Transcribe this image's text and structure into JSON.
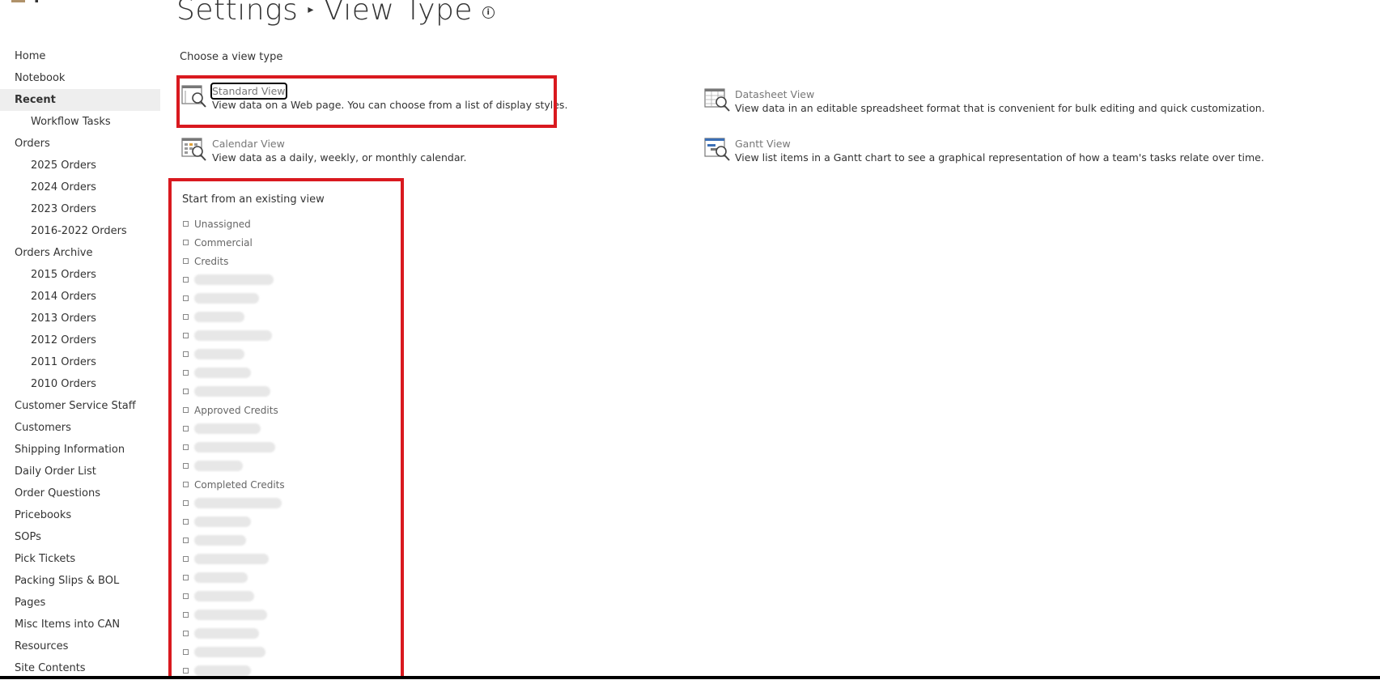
{
  "header": {
    "crumb_root": "Settings",
    "crumb_separator": "▸",
    "crumb_current": "View Type",
    "info_glyph": "i"
  },
  "nav": [
    {
      "label": "Home",
      "level": 0
    },
    {
      "label": "Notebook",
      "level": 0
    },
    {
      "label": "Recent",
      "level": 0,
      "active": true
    },
    {
      "label": "Workflow Tasks",
      "level": 1
    },
    {
      "label": "Orders",
      "level": 0
    },
    {
      "label": "2025 Orders",
      "level": 1
    },
    {
      "label": "2024 Orders",
      "level": 1
    },
    {
      "label": "2023 Orders",
      "level": 1
    },
    {
      "label": "2016-2022 Orders",
      "level": 1
    },
    {
      "label": "Orders Archive",
      "level": 0
    },
    {
      "label": "2015 Orders",
      "level": 1
    },
    {
      "label": "2014 Orders",
      "level": 1
    },
    {
      "label": "2013 Orders",
      "level": 1
    },
    {
      "label": "2012 Orders",
      "level": 1
    },
    {
      "label": "2011 Orders",
      "level": 1
    },
    {
      "label": "2010 Orders",
      "level": 1
    },
    {
      "label": "Customer Service Staff",
      "level": 0
    },
    {
      "label": "Customers",
      "level": 0
    },
    {
      "label": "Shipping Information",
      "level": 0
    },
    {
      "label": "Daily Order List",
      "level": 0
    },
    {
      "label": "Order Questions",
      "level": 0
    },
    {
      "label": "Pricebooks",
      "level": 0
    },
    {
      "label": "SOPs",
      "level": 0
    },
    {
      "label": "Pick Tickets",
      "level": 0
    },
    {
      "label": "Packing Slips & BOL",
      "level": 0
    },
    {
      "label": "Pages",
      "level": 0
    },
    {
      "label": "Misc Items into CAN",
      "level": 0
    },
    {
      "label": "Resources",
      "level": 0
    },
    {
      "label": "Site Contents",
      "level": 0
    }
  ],
  "main": {
    "choose_label": "Choose a view type",
    "view_types": {
      "standard": {
        "name": "Standard View",
        "desc": "View data on a Web page. You can choose from a list of display styles.",
        "icon": "standard-view-icon"
      },
      "datasheet": {
        "name": "Datasheet View",
        "desc": "View data in an editable spreadsheet format that is convenient for bulk editing and quick customization.",
        "icon": "datasheet-view-icon"
      },
      "calendar": {
        "name": "Calendar View",
        "desc": "View data as a daily, weekly, or monthly calendar.",
        "icon": "calendar-view-icon"
      },
      "gantt": {
        "name": "Gantt View",
        "desc": "View list items in a Gantt chart to see a graphical representation of how a team's tasks relate over time.",
        "icon": "gantt-view-icon"
      }
    },
    "existing_title": "Start from an existing view",
    "existing_views": [
      {
        "label": "Unassigned"
      },
      {
        "label": "Commercial"
      },
      {
        "label": "Credits"
      },
      {
        "label": "",
        "redacted": true
      },
      {
        "label": "",
        "redacted": true
      },
      {
        "label": "",
        "redacted": true
      },
      {
        "label": "",
        "redacted": true
      },
      {
        "label": "",
        "redacted": true
      },
      {
        "label": "",
        "redacted": true
      },
      {
        "label": "",
        "redacted": true
      },
      {
        "label": "Approved Credits"
      },
      {
        "label": "",
        "redacted": true
      },
      {
        "label": "",
        "redacted": true
      },
      {
        "label": "",
        "redacted": true
      },
      {
        "label": "Completed Credits"
      },
      {
        "label": "",
        "redacted": true
      },
      {
        "label": "",
        "redacted": true
      },
      {
        "label": "",
        "redacted": true
      },
      {
        "label": "",
        "redacted": true
      },
      {
        "label": "",
        "redacted": true
      },
      {
        "label": "",
        "redacted": true
      },
      {
        "label": "",
        "redacted": true
      },
      {
        "label": "",
        "redacted": true
      },
      {
        "label": "",
        "redacted": true
      },
      {
        "label": "",
        "redacted": true
      }
    ]
  },
  "colors": {
    "highlight": "#d9191f",
    "active_nav_bg": "#eeeeee",
    "link_gray": "#777777"
  }
}
